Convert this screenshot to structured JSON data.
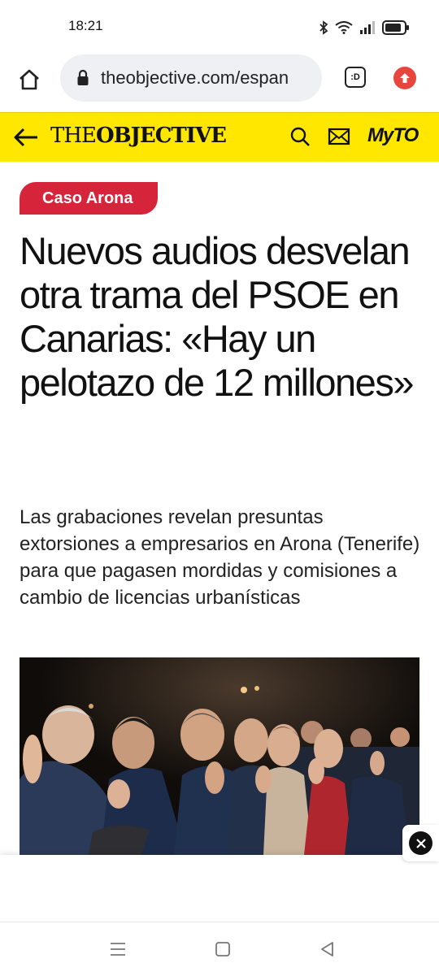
{
  "status_bar": {
    "time": "18:21",
    "icons": [
      "bluetooth-icon",
      "wifi-icon",
      "signal-icon",
      "battery-icon"
    ]
  },
  "browser": {
    "url": "theobjective.com/espan",
    "tabs_label": ":D",
    "icons": [
      "home-icon",
      "lock-icon",
      "tabs-icon",
      "upgrade-icon"
    ]
  },
  "site_header": {
    "logo_the": "THE",
    "logo_objective": "OBJECTIVE",
    "myto": "MyTO",
    "background": "#ffe700",
    "icons": [
      "back-arrow-icon",
      "search-icon",
      "mail-icon"
    ]
  },
  "article": {
    "tag": "Caso Arona",
    "tag_color": "#d6253a",
    "headline": "Nuevos audios desvelan otra trama del PSOE en Canarias: «Hay un pelotazo de 12 millones»",
    "subtitle": "Las grabaciones revelan presuntas extorsiones a empresarios en Arona (Tenerife) para que pagasen mordidas y comisiones a cambio de licencias urbanísticas"
  },
  "ad": {
    "close_icon": "close-icon"
  },
  "nav_bar": {
    "icons": [
      "menu-icon",
      "home-square-icon",
      "back-triangle-icon"
    ]
  }
}
